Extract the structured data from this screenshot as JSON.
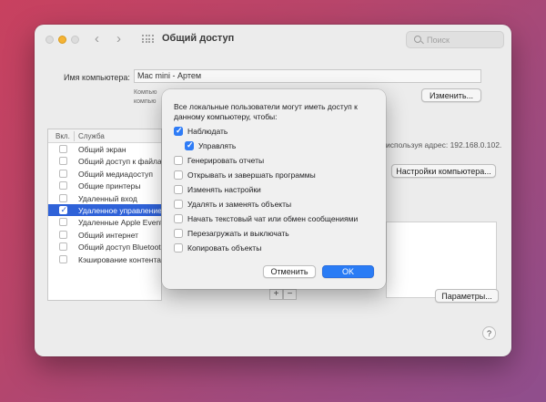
{
  "window": {
    "title": "Общий доступ",
    "search_placeholder": "Поиск"
  },
  "computer_name": {
    "label": "Имя компьютера:",
    "value": "Mac mini - Артем",
    "sub_line1": "Компью",
    "sub_line2": "компью",
    "change_button": "Изменить..."
  },
  "services": {
    "col_on": "Вкл.",
    "col_service": "Служба",
    "items": [
      {
        "label": "Общий экран",
        "checked": false,
        "selected": false
      },
      {
        "label": "Общий доступ к файлам",
        "checked": false,
        "selected": false
      },
      {
        "label": "Общий медиадоступ",
        "checked": false,
        "selected": false
      },
      {
        "label": "Общие принтеры",
        "checked": false,
        "selected": false
      },
      {
        "label": "Удаленный вход",
        "checked": false,
        "selected": false
      },
      {
        "label": "Удаленное управление",
        "checked": true,
        "selected": true
      },
      {
        "label": "Удаленные Apple Events",
        "checked": false,
        "selected": false
      },
      {
        "label": "Общий интернет",
        "checked": false,
        "selected": false
      },
      {
        "label": "Общий доступ Bluetooth",
        "checked": false,
        "selected": false
      },
      {
        "label": "Кэширование контента",
        "checked": false,
        "selected": false
      }
    ]
  },
  "right_panel": {
    "ip_text": "используя адрес: 192.168.0.102.",
    "computer_settings_button": "Настройки компьютера...",
    "params_button": "Параметры...",
    "plus": "+",
    "minus": "−",
    "help": "?"
  },
  "sheet": {
    "message": "Все локальные пользователи могут иметь доступ к данному компьютеру, чтобы:",
    "options": [
      {
        "label": "Наблюдать",
        "checked": true,
        "indent": false
      },
      {
        "label": "Управлять",
        "checked": true,
        "indent": true
      },
      {
        "label": "Генерировать отчеты",
        "checked": false,
        "indent": false
      },
      {
        "label": "Открывать и завершать программы",
        "checked": false,
        "indent": false
      },
      {
        "label": "Изменять настройки",
        "checked": false,
        "indent": false
      },
      {
        "label": "Удалять и заменять объекты",
        "checked": false,
        "indent": false
      },
      {
        "label": "Начать текстовый чат или обмен сообщениями",
        "checked": false,
        "indent": false
      },
      {
        "label": "Перезагружать и выключать",
        "checked": false,
        "indent": false
      },
      {
        "label": "Копировать объекты",
        "checked": false,
        "indent": false
      }
    ],
    "cancel_button": "Отменить",
    "ok_button": "OK"
  }
}
